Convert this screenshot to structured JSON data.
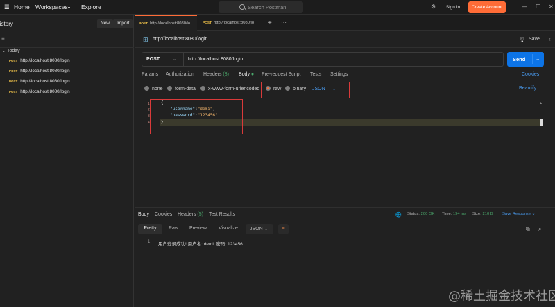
{
  "topbar": {
    "home": "Home",
    "workspaces": "Workspaces",
    "explore": "Explore",
    "search_placeholder": "Search Postman",
    "sign_in": "Sign In",
    "create_account": "Create Account"
  },
  "sidebar": {
    "title": "History",
    "new_label": "New",
    "import_label": "Import",
    "group": "Today",
    "items": [
      {
        "method": "POST",
        "url": "http://localhost:8080/login"
      },
      {
        "method": "POST",
        "url": "http://localhost:8080/login"
      },
      {
        "method": "POST",
        "url": "http://localhost:8080/login"
      },
      {
        "method": "POST",
        "url": "http://localhost:8080/login"
      }
    ]
  },
  "tabs": [
    {
      "method": "POST",
      "label": "http://localhost:8080/lo"
    },
    {
      "method": "POST",
      "label": "http://localhost:8080/lo"
    }
  ],
  "request": {
    "title": "http://localhost:8080/login",
    "save": "Save",
    "method": "POST",
    "url": "http://localhost:8080/login",
    "send": "Send",
    "options": {
      "params": "Params",
      "auth": "Authorization",
      "headers": "Headers",
      "headers_count": "(8)",
      "body": "Body",
      "prereq": "Pre-request Script",
      "tests": "Tests",
      "settings": "Settings",
      "cookies": "Cookies"
    },
    "body_types": {
      "none": "none",
      "form_data": "form-data",
      "urlencoded": "x-www-form-urlencoded",
      "raw": "raw",
      "binary": "binary",
      "format": "JSON",
      "beautify": "Beautify"
    },
    "body_lines": {
      "open": "{",
      "key1": "\"username\"",
      "val1": "\"demi\"",
      "key2": "\"password\"",
      "val2": "\"123456\"",
      "close": "}"
    },
    "line_numbers": [
      "1",
      "2",
      "3",
      "4"
    ]
  },
  "response": {
    "tabs": {
      "body": "Body",
      "cookies": "Cookies",
      "headers": "Headers",
      "headers_count": "(5)",
      "results": "Test Results"
    },
    "status_label": "Status:",
    "status": "200 OK",
    "time_label": "Time:",
    "time": "194 ms",
    "size_label": "Size:",
    "size": "210 B",
    "save_response": "Save Response",
    "views": {
      "pretty": "Pretty",
      "raw": "Raw",
      "preview": "Preview",
      "visualize": "Visualize",
      "format": "JSON"
    },
    "line": "1",
    "output": "用户登录成功! 用户名: demi, 密码: 123456"
  },
  "watermark": "@稀土掘金技术社区",
  "colors": {
    "accent": "#ff6c37",
    "send": "#0d74e7",
    "method": "#f5c64a",
    "ok": "#4aa86b",
    "highlight": "#d93a3a"
  }
}
